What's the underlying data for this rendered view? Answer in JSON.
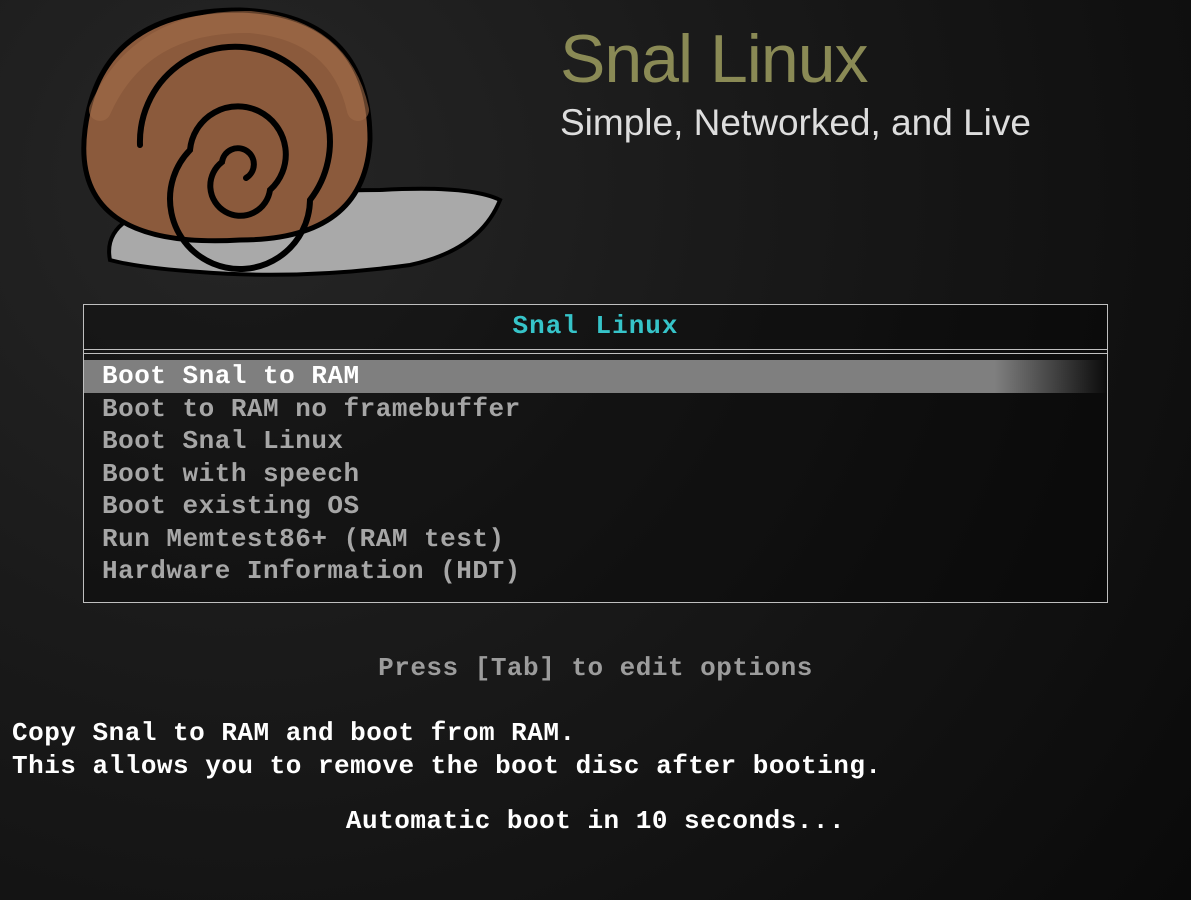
{
  "header": {
    "title": "Snal Linux",
    "subtitle": "Simple, Networked, and Live"
  },
  "menu": {
    "title": "Snal Linux",
    "items": [
      {
        "label": "Boot Snal to RAM",
        "selected": true
      },
      {
        "label": "Boot to RAM no framebuffer",
        "selected": false
      },
      {
        "label": "Boot Snal Linux",
        "selected": false
      },
      {
        "label": "Boot with speech",
        "selected": false
      },
      {
        "label": "Boot existing OS",
        "selected": false
      },
      {
        "label": "Run Memtest86+ (RAM test)",
        "selected": false
      },
      {
        "label": "Hardware Information (HDT)",
        "selected": false
      }
    ]
  },
  "hint": "Press [Tab] to edit options",
  "description": {
    "line1": "Copy Snal to RAM and boot from RAM.",
    "line2": "This allows you to remove the boot disc after booting."
  },
  "countdown": "Automatic boot in 10 seconds..."
}
